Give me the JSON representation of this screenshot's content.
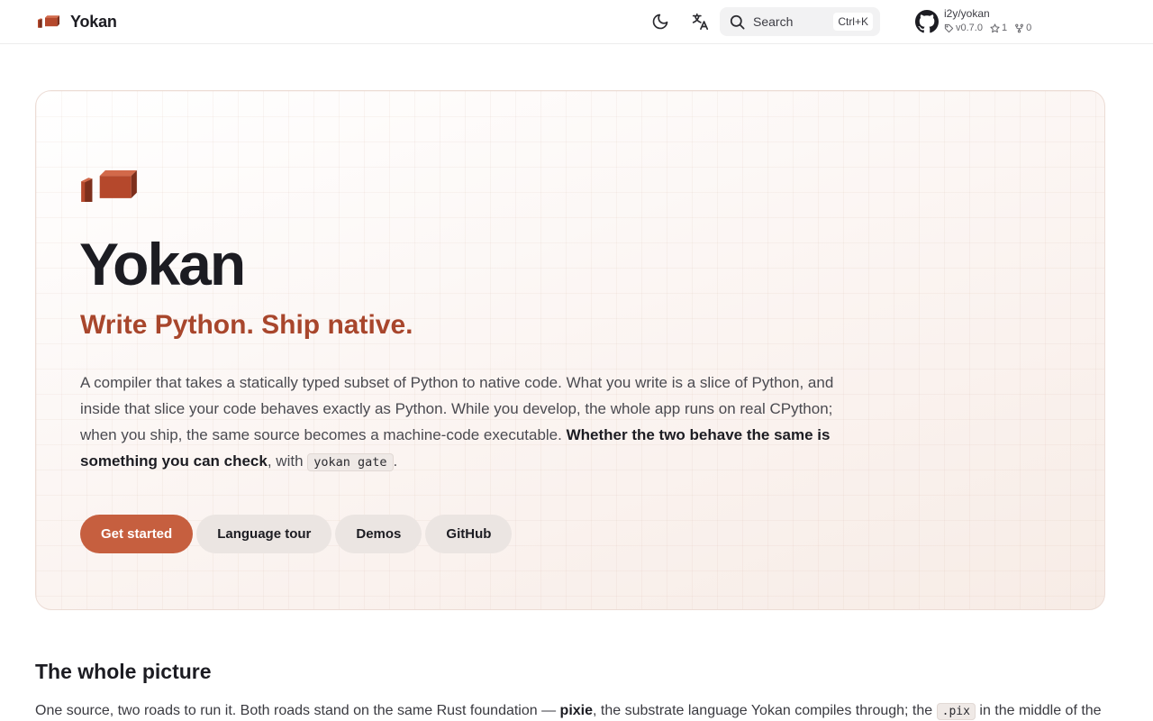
{
  "header": {
    "brand_title": "Yokan",
    "search_label": "Search",
    "search_shortcut": "Ctrl+K",
    "repo_name": "i2y/yokan",
    "repo_version": "v0.7.0",
    "repo_stars": "1",
    "repo_forks": "0"
  },
  "hero": {
    "title": "Yokan",
    "tagline": "Write Python. Ship native.",
    "desc_part1": "A compiler that takes a statically typed subset of Python to native code. What you write is a slice of Python, and inside that slice your code behaves exactly as Python. While you develop, the whole app runs on real CPython; when you ship, the same source becomes a machine-code executable. ",
    "desc_strong": "Whether the two behave the same is something you can check",
    "desc_part2": ", with ",
    "desc_code": "yokan gate",
    "desc_end": ".",
    "actions": {
      "get_started": "Get started",
      "language_tour": "Language tour",
      "demos": "Demos",
      "github": "GitHub"
    }
  },
  "section": {
    "title": "The whole picture",
    "para_part1": "One source, two roads to run it. Both roads stand on the same Rust foundation — ",
    "para_strong": "pixie",
    "para_part2": ", the substrate language Yokan compiles through; the ",
    "para_code": ".pix",
    "para_part3": " in the middle of the"
  },
  "colors": {
    "accent": "#c65f3f",
    "tagline": "#a8462c",
    "brick_front": "#b5482c",
    "brick_side": "#7d2f1c"
  },
  "icons": {
    "theme": "moon-icon",
    "language": "translate-icon",
    "search": "search-icon",
    "repo": "github-icon"
  }
}
